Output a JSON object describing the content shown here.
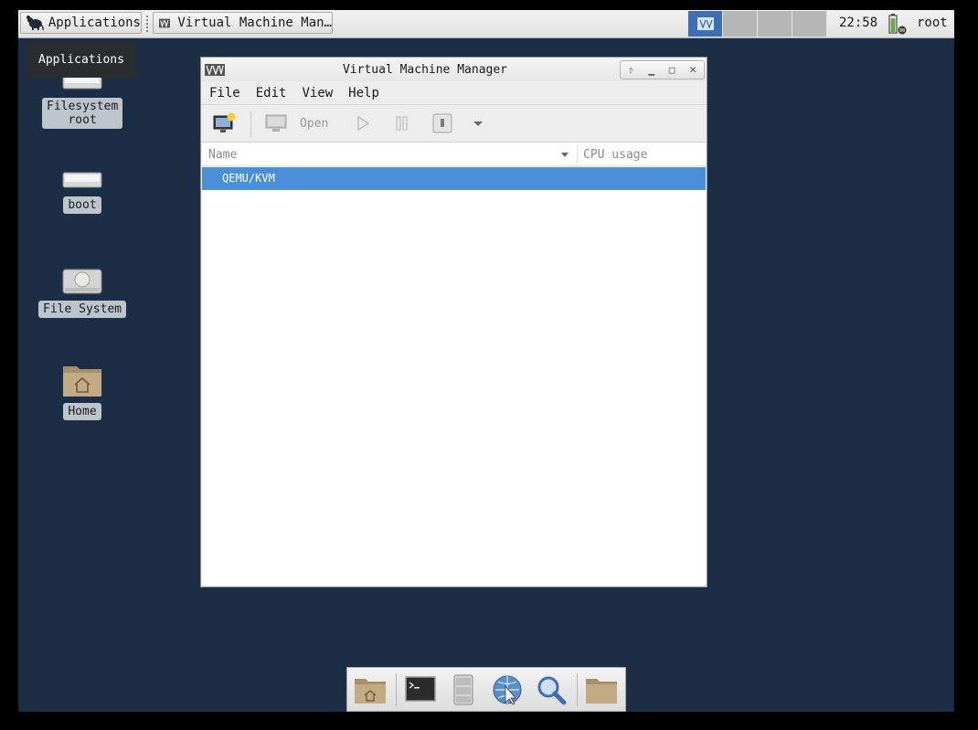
{
  "top_panel": {
    "apps_label": "Applications",
    "task_label": "Virtual Machine Man…",
    "clock": "22:58",
    "user": "root"
  },
  "tooltip": "Applications",
  "desktop": {
    "icons": [
      {
        "label_line1": "Filesystem",
        "label_line2": "root"
      },
      {
        "label": "boot"
      },
      {
        "label": "File System"
      },
      {
        "label": "Home"
      }
    ]
  },
  "window": {
    "title": "Virtual Machine Manager",
    "menu": [
      "File",
      "Edit",
      "View",
      "Help"
    ],
    "toolbar": {
      "open_label": "Open"
    },
    "columns": {
      "name": "Name",
      "cpu": "CPU usage"
    },
    "rows": [
      {
        "name": "QEMU/KVM",
        "selected": true
      }
    ]
  },
  "colors": {
    "desktop_bg": "#1b2e45",
    "selection": "#4a90d9",
    "active_workspace": "#3c6fb7"
  },
  "icons": [
    "mouse-icon",
    "vmm-icon",
    "battery-icon",
    "drive-icon",
    "home-folder-icon",
    "new-vm-icon",
    "monitor-icon",
    "play-icon",
    "pause-icon",
    "shutdown-icon",
    "dropdown-arrow-icon",
    "terminal-icon",
    "cabinet-icon",
    "browser-icon",
    "search-icon",
    "folder-icon"
  ]
}
